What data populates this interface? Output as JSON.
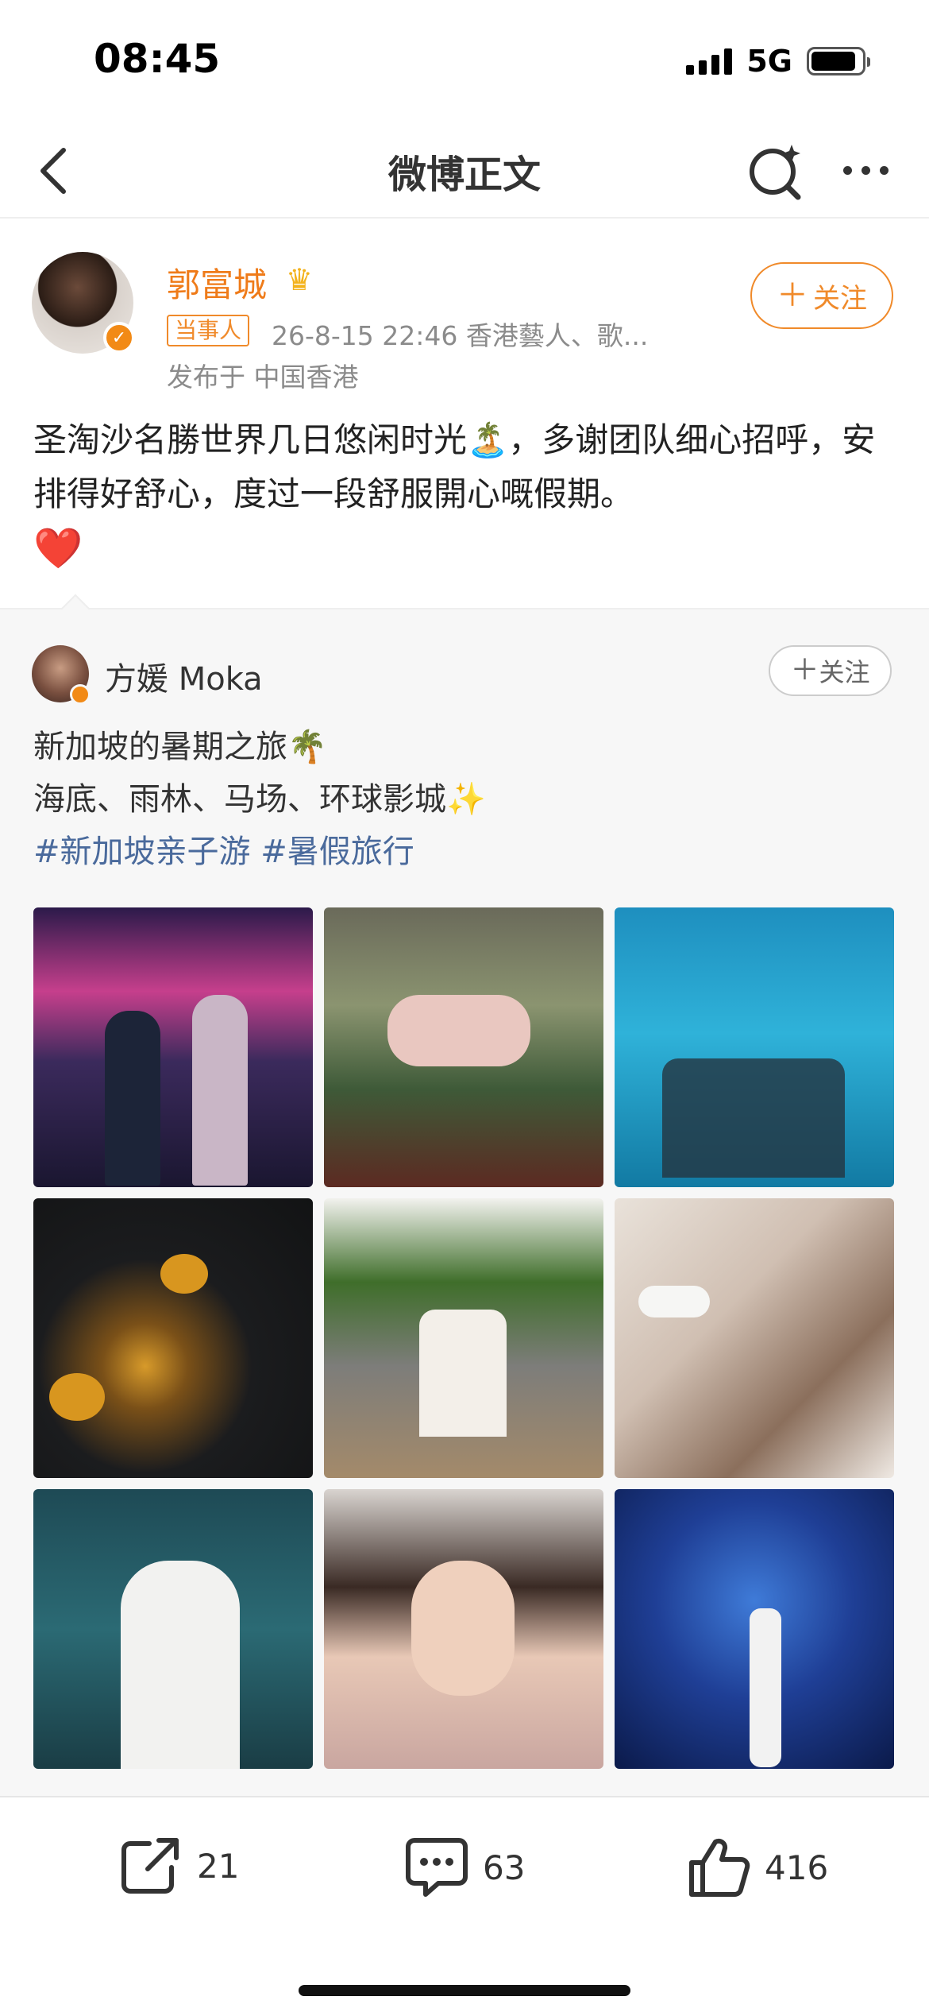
{
  "status_bar": {
    "time": "08:45",
    "network": "5G"
  },
  "nav": {
    "title": "微博正文"
  },
  "author": {
    "name": "郭富城",
    "tag": "当事人",
    "meta": "26-8-15 22:46  香港藝人、歌...",
    "location": "发布于 中国香港",
    "follow_label": "关注"
  },
  "post": {
    "text": "圣淘沙名勝世界几日悠闲时光🏝️，多谢团队细心招呼，安排得好舒心，度过一段舒服開心嘅假期。",
    "emoji": "❤️"
  },
  "repost": {
    "name": "方媛 Moka",
    "follow_label": "关注",
    "line1": "新加坡的暑期之旅🌴",
    "line2": "海底、雨林、马场、环球影城✨",
    "hashtags": [
      "#新加坡亲子游",
      "#暑假旅行"
    ]
  },
  "actions": {
    "share_count": "21",
    "comment_count": "63",
    "like_count": "416"
  },
  "colors": {
    "accent": "#ef7b19",
    "hashtag": "#4a6a9c",
    "panel": "#f7f7f7"
  },
  "icons": [
    "back-icon",
    "search-icon",
    "more-icon",
    "share-icon",
    "comment-icon",
    "like-icon"
  ]
}
